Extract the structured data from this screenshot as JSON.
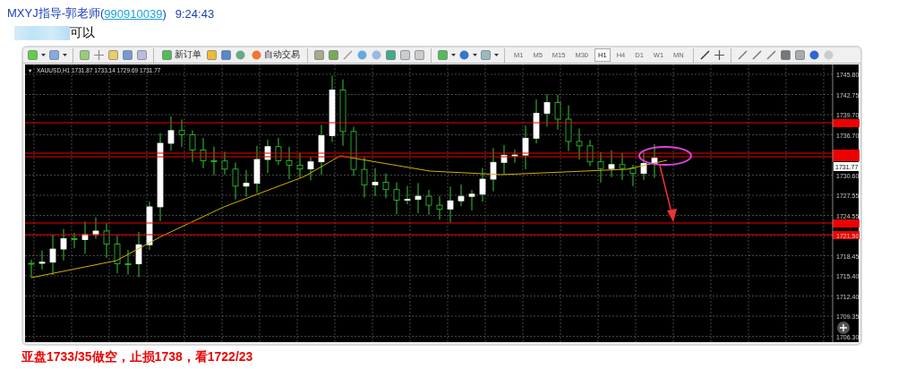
{
  "message_header": {
    "sender_name": "MXYJ指导-郭老师(",
    "sender_id": "990910039",
    "sender_name_end": ")",
    "time": "9:24:43"
  },
  "message": {
    "text": "可以"
  },
  "screenshot": {
    "toolbar": {
      "new_order_button": "新订单",
      "auto_trading_button": "自动交易",
      "timeframes": [
        {
          "label": "M1",
          "selected": false
        },
        {
          "label": "M5",
          "selected": false
        },
        {
          "label": "M15",
          "selected": false
        },
        {
          "label": "M30",
          "selected": false
        },
        {
          "label": "H1",
          "selected": true
        },
        {
          "label": "H4",
          "selected": false
        },
        {
          "label": "D1",
          "selected": false
        },
        {
          "label": "W1",
          "selected": false
        },
        {
          "label": "MN",
          "selected": false
        }
      ]
    },
    "chart": {
      "symbol_marker": "▾",
      "symbol_info": "XAUUSD,H1  1731.87 1733.14 1729.69 1731.77",
      "price_labels": [
        "1745.80",
        "1742.75",
        "1739.70",
        "1736.70",
        "1730.60",
        "1727.55",
        "1724.55",
        "1721.50",
        "1718.45",
        "1715.40",
        "1712.40",
        "1709.35",
        "1706.30"
      ],
      "current_price": "1731.77"
    }
  },
  "caption": "亚盘1733/35做空，止损1738，看1722/23"
}
